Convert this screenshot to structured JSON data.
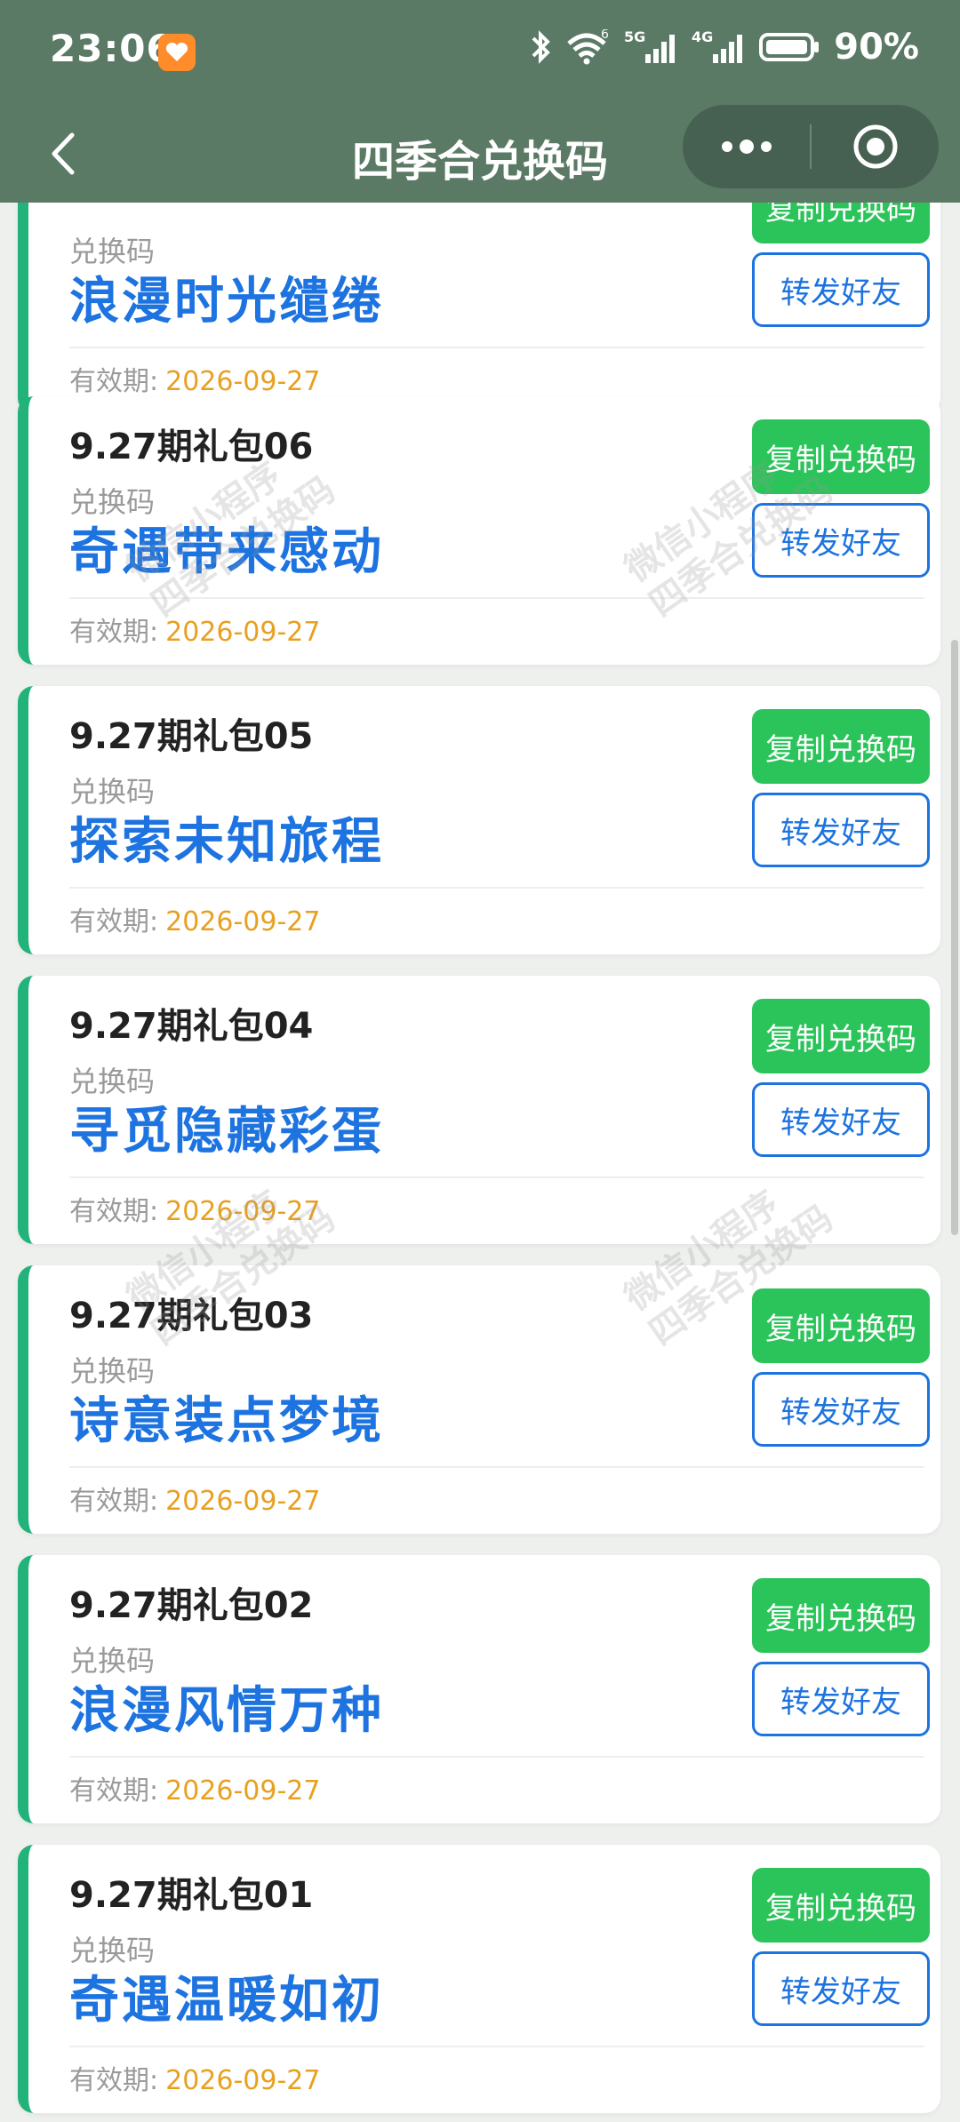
{
  "status_bar": {
    "time": "23:06",
    "battery": "90%",
    "network_5g": "5G",
    "network_4g": "4G",
    "wifi_index": "6"
  },
  "nav": {
    "title": "四季合兑换码"
  },
  "labels": {
    "code_label": "兑换码",
    "expiry_label": "有效期:",
    "copy_button": "复制兑换码",
    "share_button": "转发好友"
  },
  "watermark": {
    "line1": "微信小程序",
    "line2": "四季合兑换码"
  },
  "cards": [
    {
      "title": "",
      "code": "浪漫时光缱绻",
      "expiry": "2026-09-27"
    },
    {
      "title": "9.27期礼包06",
      "code": "奇遇带来感动",
      "expiry": "2026-09-27"
    },
    {
      "title": "9.27期礼包05",
      "code": "探索未知旅程",
      "expiry": "2026-09-27"
    },
    {
      "title": "9.27期礼包04",
      "code": "寻觅隐藏彩蛋",
      "expiry": "2026-09-27"
    },
    {
      "title": "9.27期礼包03",
      "code": "诗意装点梦境",
      "expiry": "2026-09-27"
    },
    {
      "title": "9.27期礼包02",
      "code": "浪漫风情万种",
      "expiry": "2026-09-27"
    },
    {
      "title": "9.27期礼包01",
      "code": "奇遇温暖如初",
      "expiry": "2026-09-27"
    }
  ],
  "colors": {
    "header_bg": "#5b7a65",
    "accent_green": "#2bc45a",
    "card_border": "#22b37a",
    "code_blue": "#1d73e0",
    "expiry_orange": "#e8a021"
  }
}
